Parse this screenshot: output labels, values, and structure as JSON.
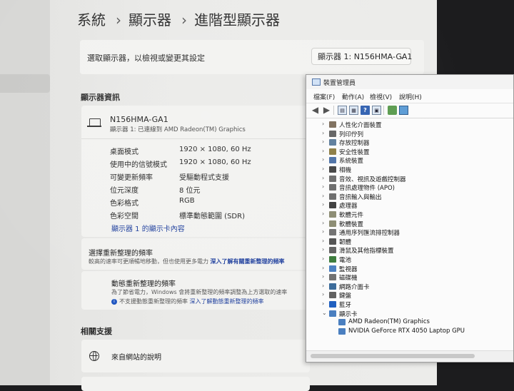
{
  "settings": {
    "breadcrumb": [
      "系統",
      "顯示器",
      "進階型顯示器"
    ],
    "select_label": "選取顯示器，以檢視或變更其設定",
    "dropdown_value": "顯示器 1: N156HMA-GA1",
    "info_section_title": "顯示器資訊",
    "monitor": {
      "name": "N156HMA-GA1",
      "connection": "顯示器 1: 已連線到 AMD Radeon(TM) Graphics"
    },
    "properties": [
      {
        "label": "桌面模式",
        "value": "1920 × 1080, 60 Hz"
      },
      {
        "label": "使用中的信號模式",
        "value": "1920 × 1080, 60 Hz"
      },
      {
        "label": "可變更新頻率",
        "value": "受驅動程式支援"
      },
      {
        "label": "位元深度",
        "value": "8 位元"
      },
      {
        "label": "色彩格式",
        "value": "RGB"
      },
      {
        "label": "色彩空間",
        "value": "標準動態範圍 (SDR)"
      }
    ],
    "adapter_link": "顯示器 1 的顯示卡內容",
    "refresh": {
      "title": "選擇重新整理的頻率",
      "desc": "較高的速率可更順暢地移動，但也使用更多電力",
      "link": "深入了解有關重新整理的頻率"
    },
    "dynamic": {
      "title": "動態重新整理的頻率",
      "desc": "為了節省電力，Windows 會將重新整理的頻率調整為上方選取的速率",
      "note": "不支援動態重新整理的頻率",
      "note_link": "深入了解動態重新整理的頻率"
    },
    "related_title": "相關支援",
    "help_text": "來自網站的說明"
  },
  "device_manager": {
    "title": "裝置管理員",
    "menus": [
      "檔案(F)",
      "動作(A)",
      "檢視(V)",
      "說明(H)"
    ],
    "tree": [
      {
        "label": "人性化介面裝置",
        "color": "#7a6a58",
        "expanded": false
      },
      {
        "label": "列印佇列",
        "color": "#606060",
        "expanded": false
      },
      {
        "label": "存放控制器",
        "color": "#5a7a9a",
        "expanded": false
      },
      {
        "label": "安全性裝置",
        "color": "#8a7a40",
        "expanded": false
      },
      {
        "label": "系統裝置",
        "color": "#4a6fa5",
        "expanded": false
      },
      {
        "label": "相機",
        "color": "#404040",
        "expanded": false
      },
      {
        "label": "音效、視訊及遊戲控制器",
        "color": "#6a6a6a",
        "expanded": false
      },
      {
        "label": "音訊處理物件 (APO)",
        "color": "#6a6a6a",
        "expanded": false
      },
      {
        "label": "音訊輸入與輸出",
        "color": "#6a6a6a",
        "expanded": false
      },
      {
        "label": "處理器",
        "color": "#3a3a3a",
        "expanded": false
      },
      {
        "label": "軟體元件",
        "color": "#8a8a70",
        "expanded": false
      },
      {
        "label": "軟體裝置",
        "color": "#8a8a70",
        "expanded": false
      },
      {
        "label": "通用序列匯流排控制器",
        "color": "#707070",
        "expanded": false
      },
      {
        "label": "韌體",
        "color": "#505050",
        "expanded": false
      },
      {
        "label": "滑鼠及其他指標裝置",
        "color": "#606060",
        "expanded": false
      },
      {
        "label": "電池",
        "color": "#3a7a3a",
        "expanded": false
      },
      {
        "label": "監視器",
        "color": "#4a7fc0",
        "expanded": false
      },
      {
        "label": "磁碟機",
        "color": "#707070",
        "expanded": false
      },
      {
        "label": "網路介面卡",
        "color": "#3a6a9a",
        "expanded": false
      },
      {
        "label": "鍵盤",
        "color": "#606060",
        "expanded": false
      },
      {
        "label": "藍牙",
        "color": "#1f5fc0",
        "expanded": false
      },
      {
        "label": "顯示卡",
        "color": "#4a7fc0",
        "expanded": true
      }
    ],
    "children": [
      {
        "label": "AMD Radeon(TM) Graphics",
        "color": "#4a7fc0"
      },
      {
        "label": "NVIDIA GeForce RTX 4050 Laptop GPU",
        "color": "#4a7fc0"
      }
    ]
  }
}
